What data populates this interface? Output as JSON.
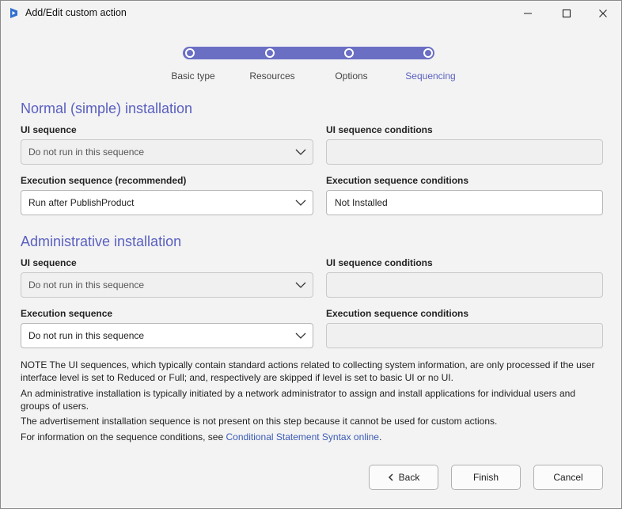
{
  "window": {
    "title": "Add/Edit custom action",
    "icon": "app-logo-icon",
    "controls": {
      "minimize": "minimize-icon",
      "maximize": "maximize-icon",
      "close": "close-icon"
    }
  },
  "stepper": {
    "steps": [
      "Basic type",
      "Resources",
      "Options",
      "Sequencing"
    ],
    "active": "Sequencing"
  },
  "normal": {
    "title": "Normal (simple) installation",
    "ui_sequence_label": "UI sequence",
    "ui_sequence_value": "Do not run in this sequence",
    "ui_conditions_label": "UI sequence conditions",
    "ui_conditions_value": "",
    "exec_sequence_label": "Execution sequence (recommended)",
    "exec_sequence_value": "Run after PublishProduct",
    "exec_conditions_label": "Execution sequence conditions",
    "exec_conditions_value": "Not Installed"
  },
  "admin": {
    "title": "Administrative installation",
    "ui_sequence_label": "UI sequence",
    "ui_sequence_value": "Do not run in this sequence",
    "ui_conditions_label": "UI sequence conditions",
    "ui_conditions_value": "",
    "exec_sequence_label": "Execution sequence",
    "exec_sequence_value": "Do not run in this sequence",
    "exec_conditions_label": "Execution sequence conditions",
    "exec_conditions_value": ""
  },
  "notes": {
    "note1": "NOTE The UI sequences, which typically contain standard actions related to collecting system information, are only processed if the user interface level is set to Reduced or Full; and, respectively are skipped if level is set to basic UI or no UI.",
    "note2": "An administrative installation is typically initiated by a network administrator to assign and install applications for individual users and groups of users.",
    "note3": "The advertisement installation sequence is not present on this step because it cannot be used for custom actions.",
    "note4_prefix": "For information on the sequence conditions, see",
    "note4_link": "Conditional Statement Syntax online",
    "note4_suffix": "."
  },
  "buttons": {
    "back": "Back",
    "finish": "Finish",
    "cancel": "Cancel"
  },
  "colors": {
    "accent": "#5a60c0",
    "track": "#6a6fc4",
    "link": "#3b5bb5"
  }
}
